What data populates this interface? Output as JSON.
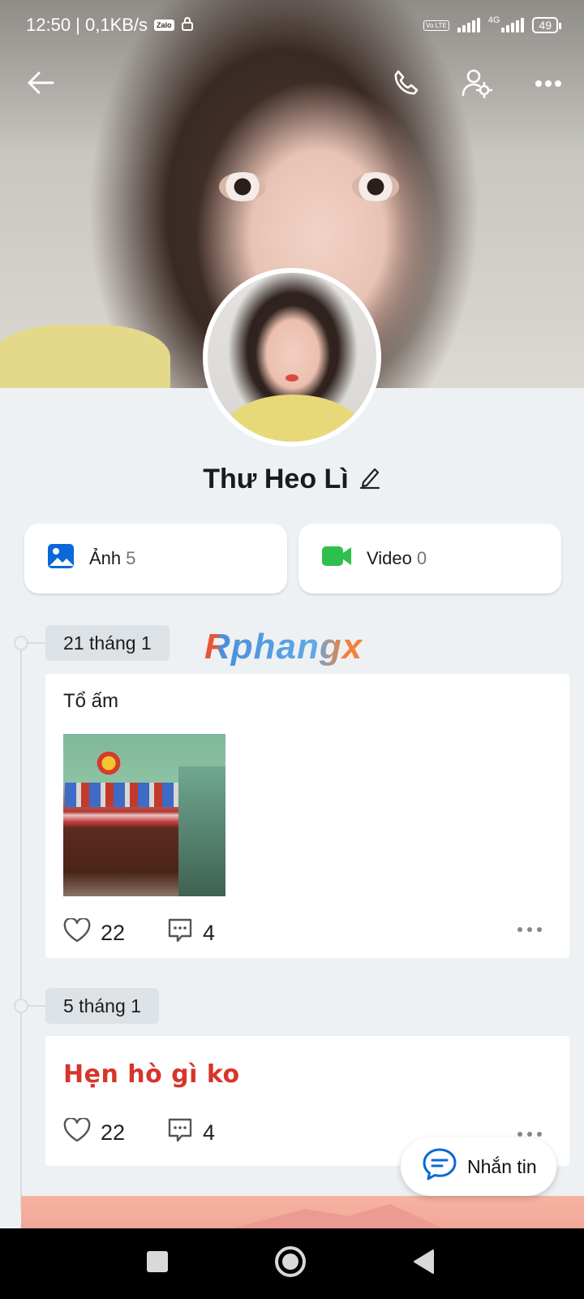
{
  "status_bar": {
    "time_speed": "12:50 | 0,1KB/s",
    "app_chip": "Zalo",
    "volte": "Vo LTE",
    "network": "4G",
    "battery": "49"
  },
  "profile": {
    "name": "Thư Heo Lì"
  },
  "media": {
    "photos_label": "Ảnh",
    "photos_count": "5",
    "video_label": "Video",
    "video_count": "0"
  },
  "watermark": "Rphangx",
  "posts": [
    {
      "date": "21 tháng 1",
      "text": "Tổ ấm",
      "likes": "22",
      "comments": "4"
    },
    {
      "date": "5 tháng 1",
      "text": "Hẹn hò gì ko",
      "likes": "22",
      "comments": "4"
    }
  ],
  "fab": {
    "label": "Nhắn tin"
  },
  "icons": {
    "back": "arrow-left-icon",
    "call": "phone-icon",
    "profile_settings": "user-gear-icon",
    "more": "more-horizontal-icon",
    "edit": "pencil-icon",
    "photos": "image-icon",
    "video": "video-camera-icon",
    "like": "heart-icon",
    "comment": "comment-icon",
    "message": "chat-bubble-icon"
  },
  "colors": {
    "accent_blue": "#0a68d8",
    "video_green": "#2fbf4d",
    "post_red_text": "#d7352b"
  }
}
